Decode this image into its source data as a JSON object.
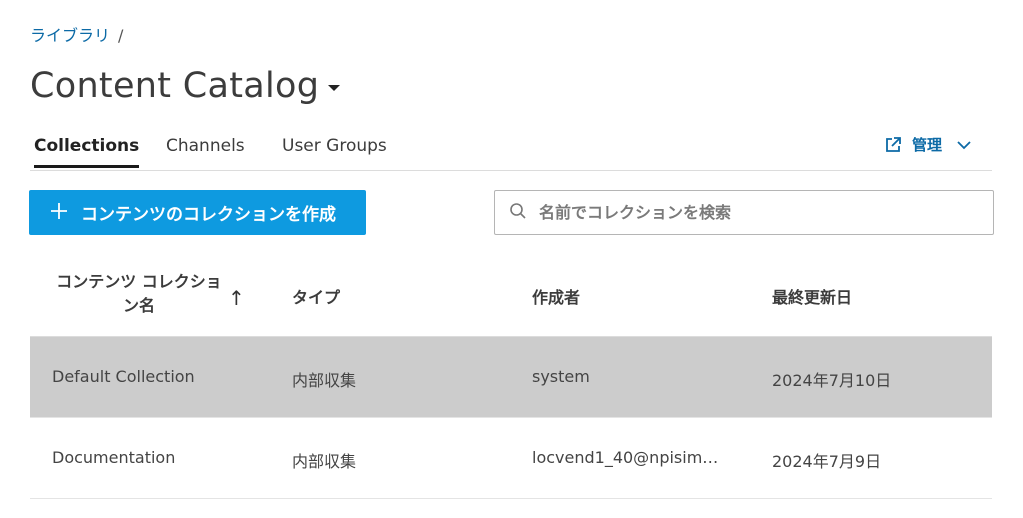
{
  "breadcrumb": {
    "root": "ライブラリ",
    "separator": "/"
  },
  "page": {
    "title": "Content Catalog"
  },
  "tabs": [
    {
      "label": "Collections",
      "active": true
    },
    {
      "label": "Channels",
      "active": false
    },
    {
      "label": "User Groups",
      "active": false
    }
  ],
  "manage": {
    "label": "管理",
    "icon": "external-link-icon"
  },
  "create_button": {
    "label": "コンテンツのコレクションを作成",
    "icon": "plus-icon",
    "color": "#0e9ae0"
  },
  "search": {
    "placeholder": "名前でコレクションを検索",
    "value": ""
  },
  "table": {
    "headers": {
      "name": "コンテンツ コレクション名",
      "type": "タイプ",
      "creator": "作成者",
      "updated": "最終更新日"
    },
    "sort": {
      "column": "name",
      "direction": "ascending"
    },
    "rows": [
      {
        "name": "Default Collection",
        "type": "内部収集",
        "creator": "system",
        "updated": "2024年7月10日",
        "selected": true
      },
      {
        "name": "Documentation",
        "type": "内部収集",
        "creator": "locvend1_40@npisim…",
        "updated": "2024年7月9日",
        "selected": false
      }
    ]
  }
}
